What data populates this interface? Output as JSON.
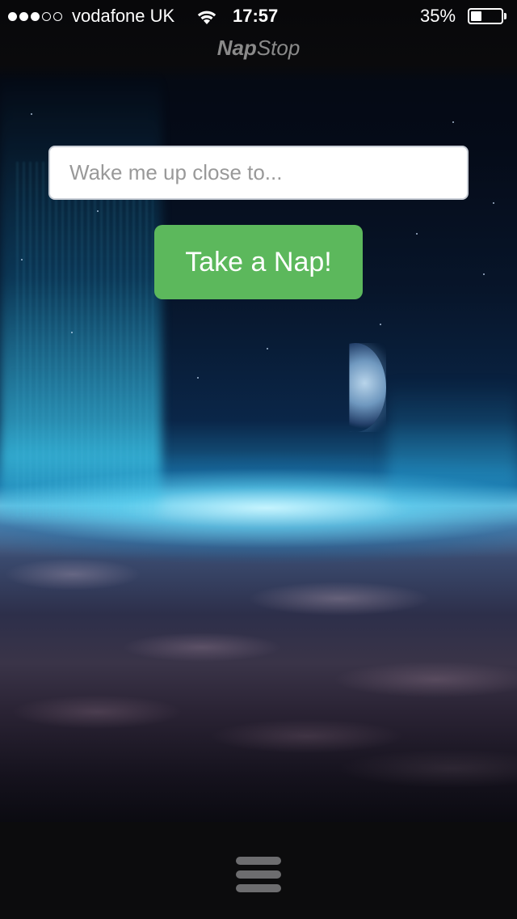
{
  "status_bar": {
    "signal_bars_filled": 3,
    "signal_bars_total": 5,
    "carrier": "vodafone UK",
    "wifi_icon": "wifi-icon",
    "time": "17:57",
    "battery_percent_text": "35%",
    "battery_level": 0.35
  },
  "nav": {
    "title_bold": "Nap",
    "title_rest": "Stop"
  },
  "form": {
    "destination_placeholder": "Wake me up close to...",
    "destination_value": "",
    "submit_label": "Take a Nap!"
  },
  "bottom_bar": {
    "menu_icon": "hamburger-menu-icon"
  },
  "colors": {
    "button_green": "#5cb85c",
    "title_gray": "#8a8a8a",
    "bar_dark": "#0c0c0e"
  }
}
